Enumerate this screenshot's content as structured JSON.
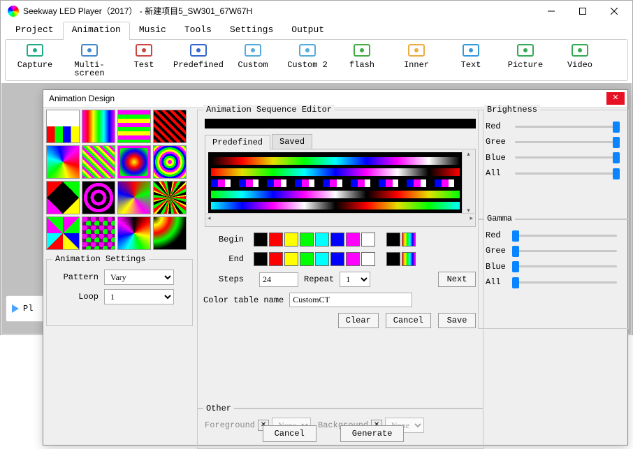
{
  "main": {
    "title": "Seekway LED Player（2017） - 新建项目5_SW301_67W67H",
    "menus": [
      "Project",
      "Animation",
      "Music",
      "Tools",
      "Settings",
      "Output"
    ],
    "active_menu": 1,
    "toolbar": [
      "Capture",
      "Multi-screen",
      "Test",
      "Predefined",
      "Custom",
      "Custom 2",
      "flash",
      "Inner",
      "Text",
      "Picture",
      "Video"
    ],
    "play_label": "Pl"
  },
  "dialog": {
    "title": "Animation Design",
    "anim_settings": {
      "group": "Animation Settings",
      "pattern_label": "Pattern",
      "pattern_value": "Vary",
      "loop_label": "Loop",
      "loop_value": "1"
    },
    "seq": {
      "group": "Animation Sequence Editor",
      "tabs": [
        "Predefined",
        "Saved"
      ],
      "active_tab": 0,
      "begin_label": "Begin",
      "end_label": "End",
      "steps_label": "Steps",
      "steps_value": "24",
      "repeat_label": "Repeat",
      "repeat_value": "1",
      "next_label": "Next",
      "ctname_label": "Color table name",
      "ctname_value": "CustomCT",
      "clear": "Clear",
      "cancel": "Cancel",
      "save": "Save"
    },
    "other": {
      "group": "Other",
      "fg_label": "Foreground",
      "fg_value": "None",
      "bg_label": "Background",
      "bg_value": "None"
    },
    "brightness": {
      "group": "Brightness",
      "labels": [
        "Red",
        "Gree",
        "Blue",
        "All"
      ]
    },
    "gamma": {
      "group": "Gamma",
      "labels": [
        "Red",
        "Gree",
        "Blue",
        "All"
      ]
    },
    "btn_cancel": "Cancel",
    "btn_generate": "Generate"
  }
}
